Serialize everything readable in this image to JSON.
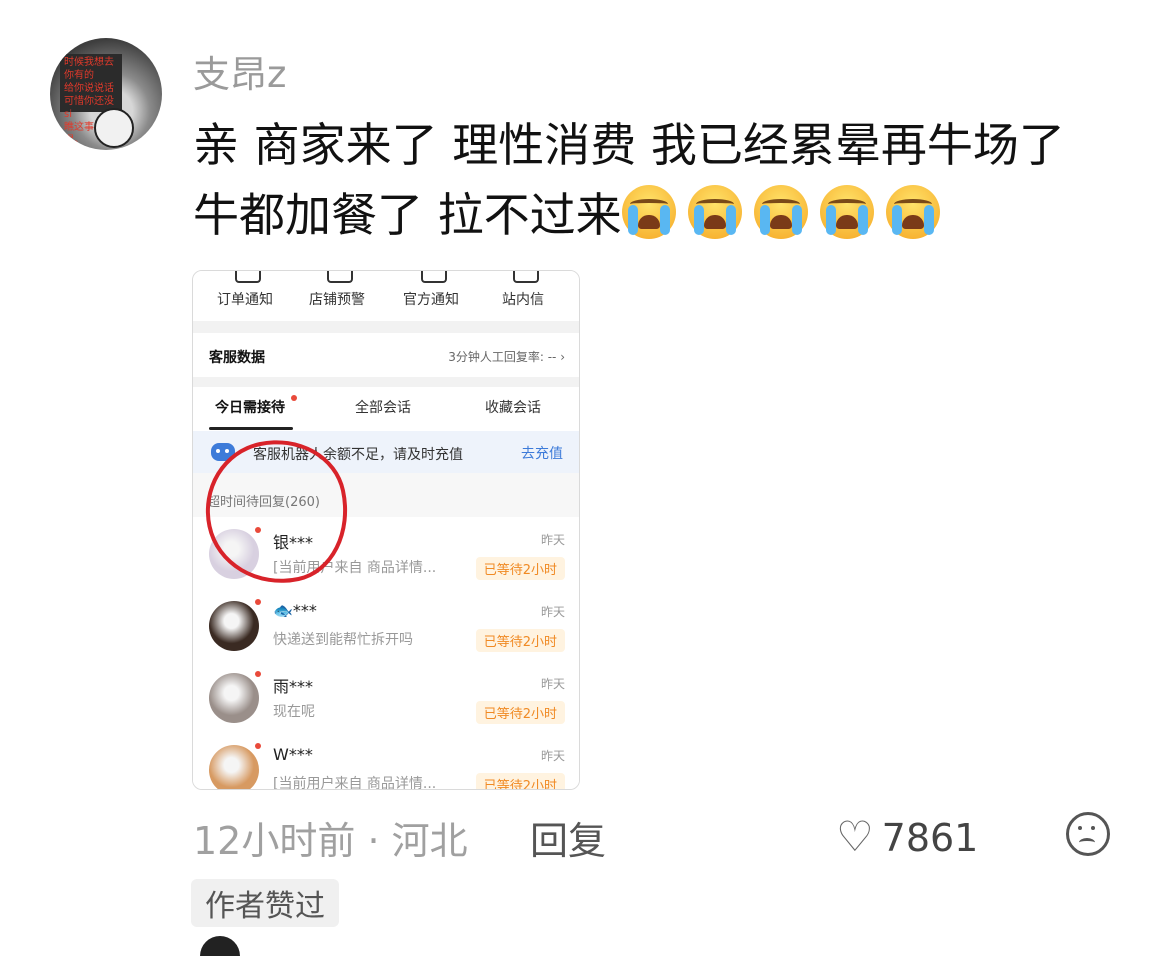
{
  "comment": {
    "username": "支昂z",
    "avatar_text": "时候我想去你有的\n给你说说话\n可惜你还没si\n瞧这事闹得。",
    "text": "亲 商家来了 理性消费  我已经累晕再牛场了 牛都加餐了 拉不过来",
    "emoji_count": 5,
    "emoji_name": "loudly-crying-face-icon",
    "time": "12小时前",
    "location": "河北",
    "separator": "·",
    "reply_label": "回复",
    "like_count": "7861",
    "liked_by_author": "作者赞过"
  },
  "screenshot": {
    "icon_row": [
      "订单通知",
      "店铺预警",
      "官方通知",
      "站内信"
    ],
    "service_title": "客服数据",
    "service_rate": "3分钟人工回复率: -- ",
    "tabs": [
      "今日需接待",
      "全部会话",
      "收藏会话"
    ],
    "banner_text": "客服机器人余额不足，请及时充值",
    "banner_action": "去充值",
    "section_label": "超时间待回复(260)",
    "chats": [
      {
        "name": "银***",
        "msg": "[当前用户来自 商品详情...",
        "time": "昨天",
        "badge": "已等待2小时",
        "color": "#d8d0e0"
      },
      {
        "name": "🐟***",
        "msg": "快递送到能帮忙拆开吗",
        "time": "昨天",
        "badge": "已等待2小时",
        "color": "#3a2a22"
      },
      {
        "name": "雨***",
        "msg": "现在呢",
        "time": "昨天",
        "badge": "已等待2小时",
        "color": "#9a8f8a"
      },
      {
        "name": "W***",
        "msg": "[当前用户来自 商品详情...",
        "time": "昨天",
        "badge": "已等待2小时",
        "color": "#d79a62"
      }
    ]
  },
  "colors": {
    "red_mark": "#d8232a",
    "badge_orange": "#f08a24",
    "banner_blue": "#3d7bd9"
  }
}
